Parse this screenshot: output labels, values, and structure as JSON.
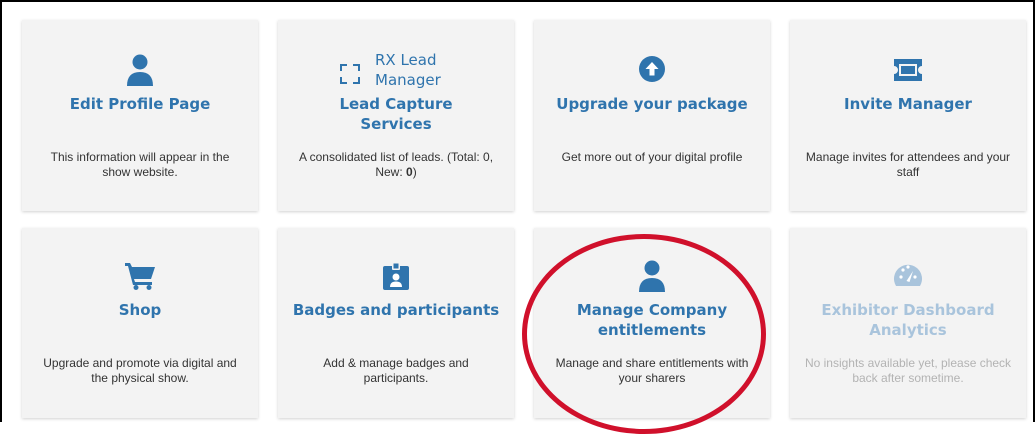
{
  "cards": [
    {
      "title": "Edit Profile Page",
      "desc": "This information will appear in the show website.",
      "icon": "person-icon"
    },
    {
      "title": "Lead Capture Services",
      "rx_label": "RX Lead Manager",
      "desc_prefix": "A consolidated list of leads. (Total: 0, New: ",
      "desc_new": "0",
      "desc_suffix": ")",
      "icon": "scan-icon"
    },
    {
      "title": "Upgrade your package",
      "desc": "Get more out of your digital profile",
      "icon": "arrow-up-circle-icon"
    },
    {
      "title": "Invite Manager",
      "desc": "Manage invites for attendees and your staff",
      "icon": "ticket-icon"
    },
    {
      "title": "Shop",
      "desc": "Upgrade and promote via digital and the physical show.",
      "icon": "cart-icon"
    },
    {
      "title": "Badges and participants",
      "desc": "Add & manage badges and participants.",
      "icon": "badge-icon"
    },
    {
      "title": "Manage Company entitlements",
      "desc": "Manage and share entitlements with your sharers",
      "icon": "person-icon"
    },
    {
      "title": "Exhibitor Dashboard Analytics",
      "desc": "No insights available yet, please check back after sometime.",
      "icon": "gauge-icon",
      "state": "disabled"
    }
  ],
  "colors": {
    "accent": "#2f74ad",
    "highlight": "#d0102b",
    "disabled": "#a9c4dc"
  }
}
